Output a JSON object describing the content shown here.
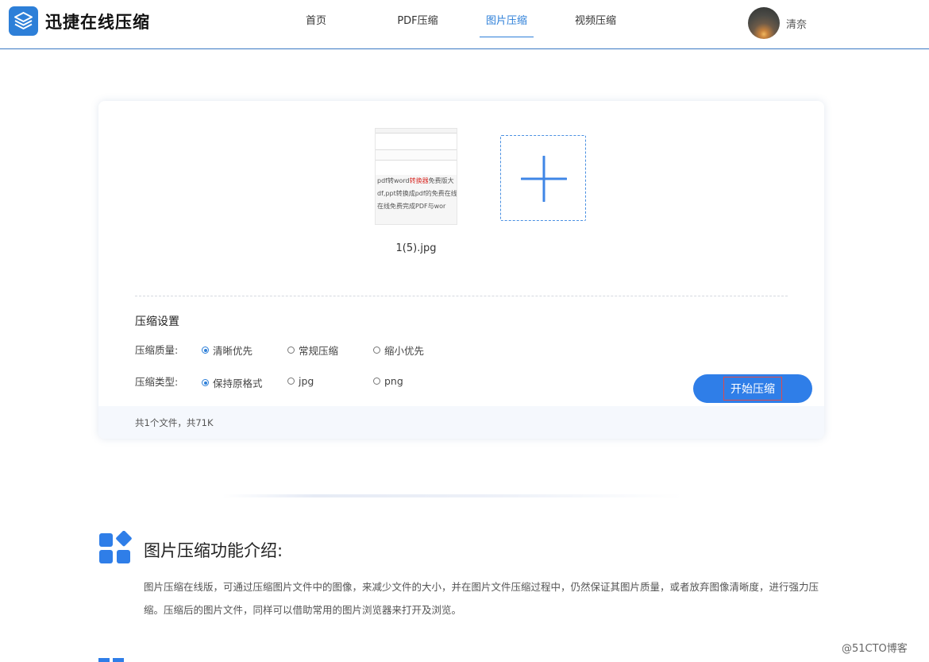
{
  "header": {
    "logo_text": "迅捷在线压缩",
    "nav": [
      {
        "label": "首页"
      },
      {
        "label": "PDF压缩"
      },
      {
        "label": "图片压缩"
      },
      {
        "label": "视频压缩"
      }
    ],
    "active_nav": "图片压缩",
    "username": "清奈"
  },
  "upload": {
    "file_name": "1(5).jpg",
    "thumb_lines": [
      {
        "a": "pdf转word",
        "b": "转换器",
        "c": "免费版大"
      },
      {
        "a": "df,ppt转换成pdf的免费在线",
        "b": "",
        "c": ""
      },
      {
        "a": "在线免费完成PDF与wor",
        "b": "",
        "c": ""
      }
    ]
  },
  "settings": {
    "title": "压缩设置",
    "quality_label": "压缩质量:",
    "quality_options": [
      "清晰优先",
      "常规压缩",
      "缩小优先"
    ],
    "quality_selected": "清晰优先",
    "type_label": "压缩类型:",
    "type_options": [
      "保持原格式",
      "jpg",
      "png"
    ],
    "type_selected": "保持原格式"
  },
  "start_button": "开始压缩",
  "footer_status": "共1个文件，共71K",
  "intro": {
    "title": "图片压缩功能介绍:",
    "text": "图片压缩在线版，可通过压缩图片文件中的图像，来减少文件的大小，并在图片文件压缩过程中，仍然保证其图片质量，或者放弃图像清晰度，进行强力压缩。压缩后的图片文件，同样可以借助常用的图片浏览器来打开及浏览。"
  },
  "watermark": "@51CTO博客",
  "colors": {
    "accent": "#2d7fd8",
    "button": "#2f7ee8",
    "footer_bg": "#f5f8fd"
  },
  "icons": [
    "logo-layers-icon",
    "plus-icon",
    "app-grid-icon"
  ]
}
